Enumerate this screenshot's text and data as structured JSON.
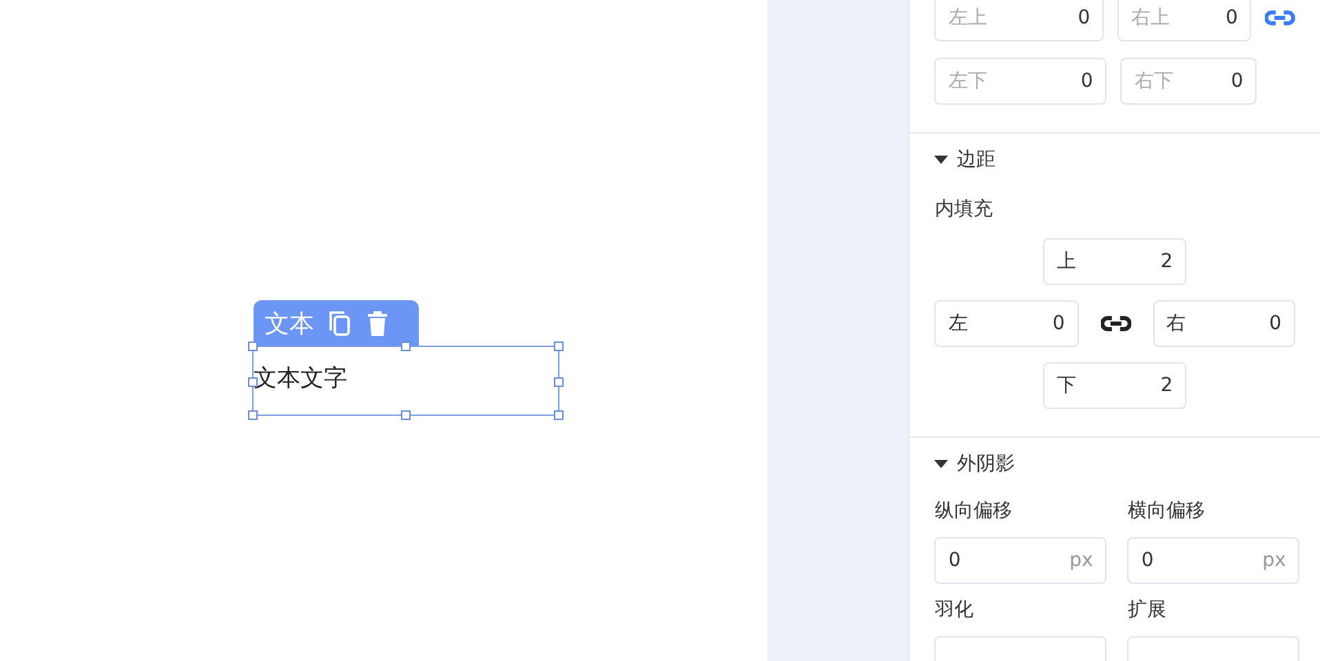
{
  "canvas": {
    "element_toolbar": {
      "label": "文本"
    },
    "element_text": "文本文字",
    "selected": true
  },
  "radius": {
    "linked": true,
    "fields": [
      {
        "label": "左上",
        "value": "0"
      },
      {
        "label": "右上",
        "value": "0"
      },
      {
        "label": "左下",
        "value": "0"
      },
      {
        "label": "右下",
        "value": "0"
      }
    ]
  },
  "margin_section": {
    "title": "边距",
    "expanded": true,
    "padding_label": "内填充",
    "linked": false,
    "fields": [
      {
        "label": "上",
        "value": "2"
      },
      {
        "label": "左",
        "value": "0"
      },
      {
        "label": "右",
        "value": "0"
      },
      {
        "label": "下",
        "value": "2"
      }
    ]
  },
  "shadow_section": {
    "title": "外阴影",
    "expanded": true,
    "fields": [
      {
        "label": "纵向偏移",
        "value": "0",
        "unit": "px"
      },
      {
        "label": "横向偏移",
        "value": "0",
        "unit": "px"
      },
      {
        "label": "羽化"
      },
      {
        "label": "扩展"
      }
    ]
  }
}
